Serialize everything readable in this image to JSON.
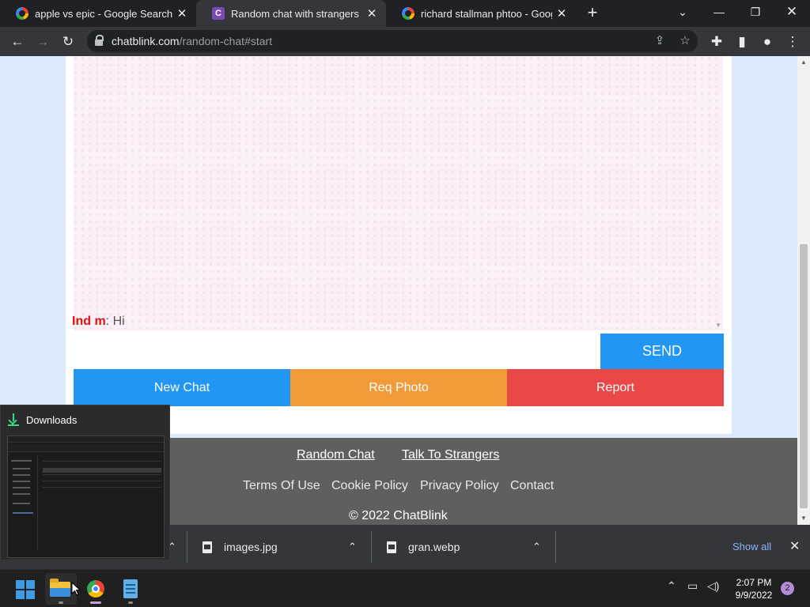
{
  "browser": {
    "tabs": [
      {
        "title": "apple vs epic - Google Search",
        "favicon": "google-icon",
        "active": false
      },
      {
        "title": "Random chat with strangers",
        "favicon": "chatblink-icon",
        "favicon_letter": "C",
        "active": true
      },
      {
        "title": "richard stallman phtoo - Google",
        "favicon": "google-icon",
        "active": false
      }
    ],
    "url_host": "chatblink.com",
    "url_path": "/random-chat#start"
  },
  "chat": {
    "messages": [
      {
        "sender": "Ind m",
        "separator": ":",
        "text": " Hi"
      }
    ],
    "send_label": "SEND",
    "input_value": "",
    "actions": {
      "new_chat": "New Chat",
      "req_photo": "Req Photo",
      "report": "Report"
    },
    "colors": {
      "send": "#2196f3",
      "new_chat": "#2196f3",
      "req_photo": "#f29a38",
      "report": "#ea4747",
      "sender": "#e01010"
    }
  },
  "footer": {
    "primary_links": [
      "Random Chat",
      "Talk To Strangers"
    ],
    "secondary_links": [
      "Terms Of Use",
      "Cookie Policy",
      "Privacy Policy",
      "Contact"
    ],
    "copyright": "© 2022 ChatBlink"
  },
  "downloads": {
    "items": [
      {
        "name": "images.jpg"
      },
      {
        "name": "gran.webp"
      }
    ],
    "show_all": "Show all"
  },
  "taskbar_popup": {
    "title": "Downloads"
  },
  "taskbar": {
    "apps": [
      "start",
      "file-explorer",
      "chrome",
      "notepad"
    ],
    "time": "2:07 PM",
    "date": "9/9/2022",
    "notification_count": "2"
  }
}
